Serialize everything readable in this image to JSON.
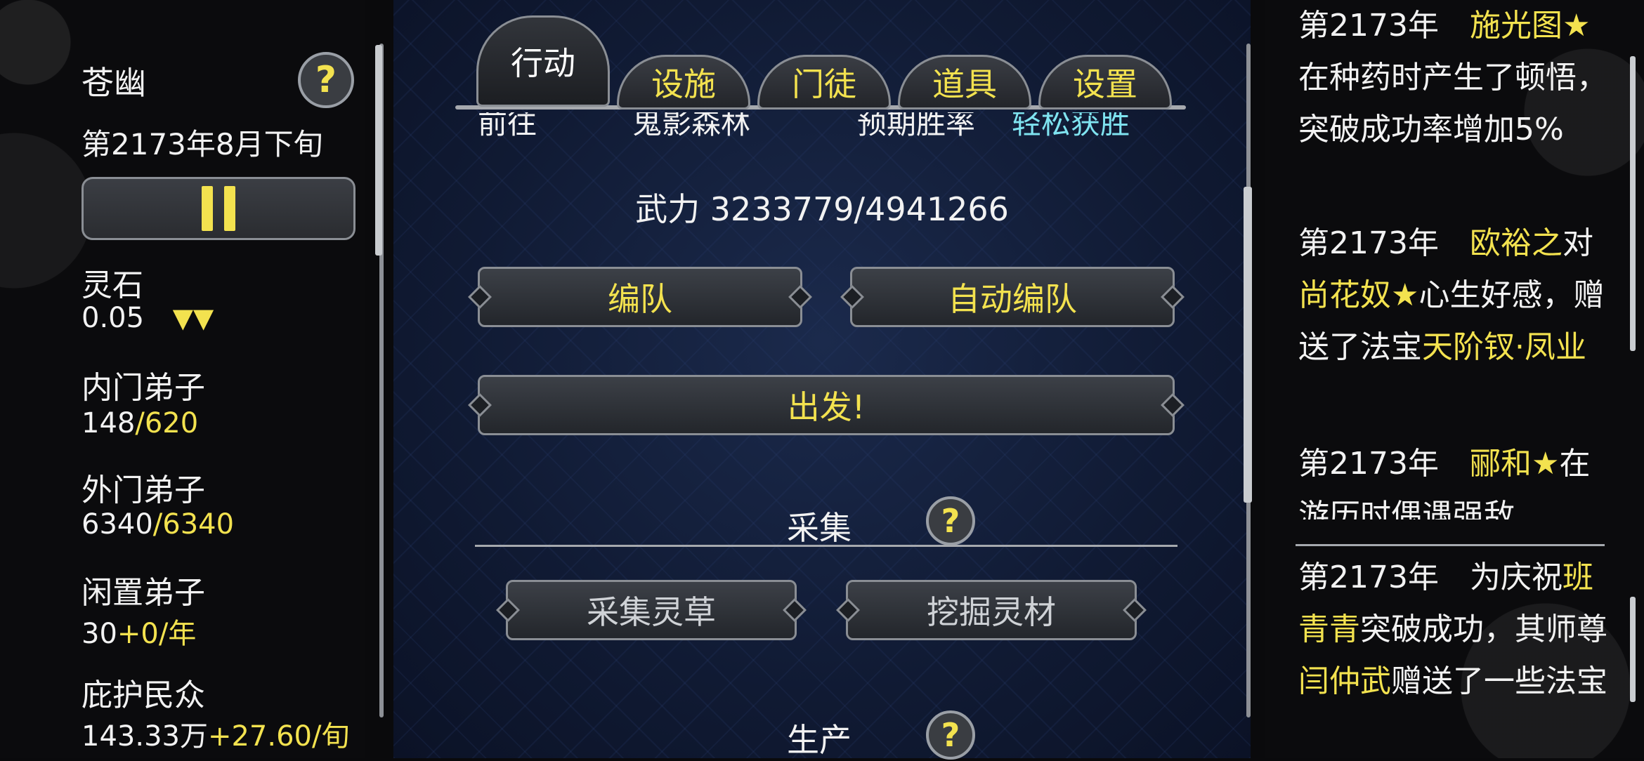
{
  "sidebar": {
    "sect_name": "苍幽",
    "date": "第2173年8月下旬",
    "help": "?",
    "spirit_stone": {
      "label": "灵石",
      "value": "0.05",
      "trend": "▼▼"
    },
    "inner_disciples": {
      "label": "内门弟子",
      "current": "148",
      "max": "/620"
    },
    "outer_disciples": {
      "label": "外门弟子",
      "current": "6340",
      "max": "/6340"
    },
    "idle_disciples": {
      "label": "闲置弟子",
      "current": "30",
      "rate": "+0/年"
    },
    "protected_people": {
      "label": "庇护民众",
      "current": "143.33万",
      "rate": "+27.60/旬"
    }
  },
  "tabs": [
    {
      "label": "行动",
      "active": true
    },
    {
      "label": "设施",
      "active": false
    },
    {
      "label": "门徒",
      "active": false
    },
    {
      "label": "道具",
      "active": false
    },
    {
      "label": "设置",
      "active": false
    }
  ],
  "action": {
    "cut_row": {
      "goto": "前往",
      "destination": "鬼影森林",
      "expected_label": "预期胜率",
      "expected_value": "轻松获胜"
    },
    "power": "武力 3233779/4941266",
    "formation_btn": "编队",
    "auto_formation_btn": "自动编队",
    "depart_btn": "出发!",
    "gather": {
      "title": "采集",
      "help": "?",
      "herb_btn": "采集灵草",
      "dig_btn": "挖掘灵材"
    },
    "produce": {
      "title": "生产",
      "help": "?"
    }
  },
  "log": {
    "entry1": {
      "year": "第2173年",
      "name": "施光图★",
      "text": "在种药时产生了顿悟，突破成功率增加5%"
    },
    "entry2": {
      "year": "第2173年",
      "name1": "欧裕之",
      "mid1": "对",
      "name2": "尚花奴★",
      "mid2": "心生好感，赠送了法宝",
      "item": "天阶钗·凤业"
    },
    "entry3": {
      "year": "第2173年",
      "name": "郦和★",
      "text": "在游历时偶遇强敌"
    },
    "entry4": {
      "year": "第2173年",
      "pre": "为庆祝",
      "name1": "班青青",
      "mid": "突破成功，其师尊",
      "name2": "闫仲武",
      "post": "赠送了一些法宝"
    }
  }
}
